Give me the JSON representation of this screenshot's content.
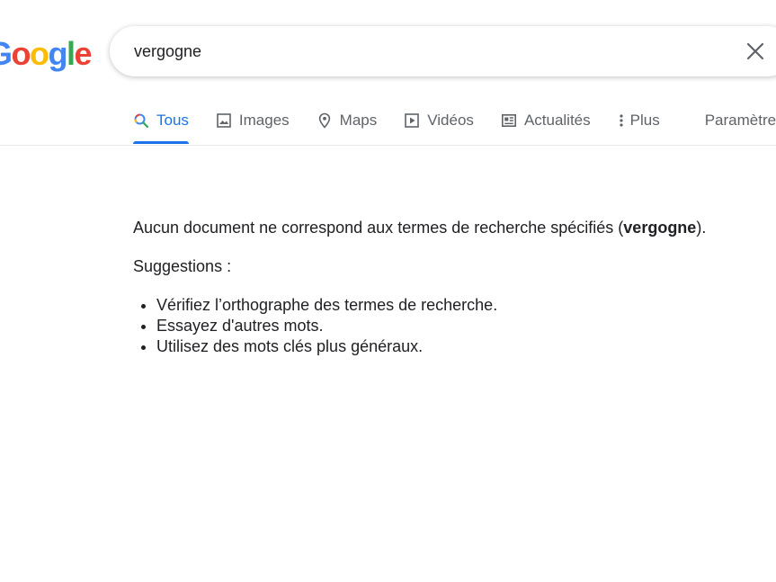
{
  "logo": {
    "letters": [
      "G",
      "o",
      "o",
      "g",
      "l",
      "e"
    ]
  },
  "search": {
    "value": "vergogne",
    "clear_icon": "close-icon"
  },
  "tabs": [
    {
      "label": "Tous",
      "icon": "search-icon",
      "active": true
    },
    {
      "label": "Images",
      "icon": "image-icon"
    },
    {
      "label": "Maps",
      "icon": "map-pin-icon"
    },
    {
      "label": "Vidéos",
      "icon": "play-video-icon"
    },
    {
      "label": "Actualités",
      "icon": "news-icon"
    },
    {
      "label": "Plus",
      "icon": "more-vertical-icon"
    },
    {
      "label": "Paramètres"
    }
  ],
  "results": {
    "no_result_prefix": "Aucun document ne correspond aux termes de recherche spécifiés (",
    "query": "vergogne",
    "no_result_suffix": ").",
    "suggestions_title": "Suggestions :",
    "suggestions": [
      "Vérifiez l’orthographe des termes de recherche.",
      "Essayez d'autres mots.",
      "Utilisez des mots clés plus généraux."
    ]
  },
  "colors": {
    "accent": "#1a73e8",
    "tab_text": "#5f6368",
    "text": "#202124",
    "logo_blue": "#4285f4",
    "logo_red": "#ea4335",
    "logo_yellow": "#fbbc05",
    "logo_green": "#34a853"
  }
}
